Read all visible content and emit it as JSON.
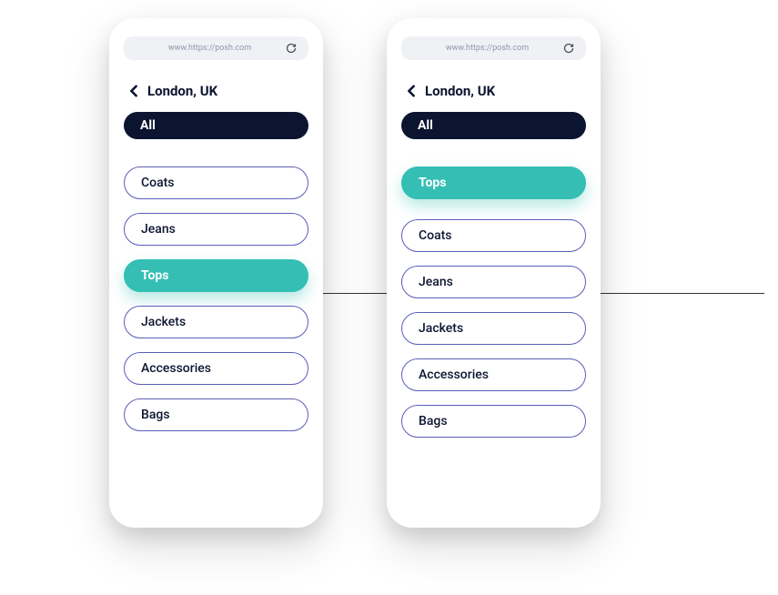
{
  "url": "www.https://posh.com",
  "location": "London, UK",
  "all_label": "All",
  "phone1": {
    "categories": [
      {
        "label": "Coats",
        "selected": false
      },
      {
        "label": "Jeans",
        "selected": false
      },
      {
        "label": "Tops",
        "selected": true
      },
      {
        "label": "Jackets",
        "selected": false
      },
      {
        "label": "Accessories",
        "selected": false
      },
      {
        "label": "Bags",
        "selected": false
      }
    ]
  },
  "phone2": {
    "selected_category": "Tops",
    "categories": [
      {
        "label": "Coats",
        "selected": false
      },
      {
        "label": "Jeans",
        "selected": false
      },
      {
        "label": "Jackets",
        "selected": false
      },
      {
        "label": "Accessories",
        "selected": false
      },
      {
        "label": "Bags",
        "selected": false
      }
    ]
  }
}
